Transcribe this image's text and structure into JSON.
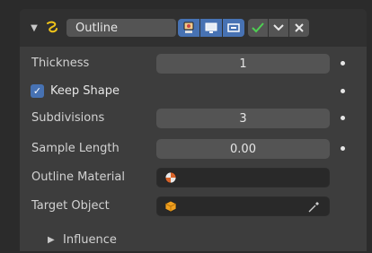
{
  "modifier": {
    "name": "Outline",
    "icon": "grease-pencil-icon",
    "toggle_icons": [
      "render-icon",
      "viewport-icon",
      "editmode-icon"
    ],
    "action_icons": [
      "apply-check-icon",
      "dropdown-chevron-icon",
      "close-icon"
    ]
  },
  "properties": {
    "thickness": {
      "label": "Thickness",
      "value": "1"
    },
    "keep_shape": {
      "label": "Keep Shape",
      "checked": true
    },
    "subdivisions": {
      "label": "Subdivisions",
      "value": "3"
    },
    "sample_length": {
      "label": "Sample Length",
      "value": "0.00"
    },
    "outline_material": {
      "label": "Outline Material",
      "value": ""
    },
    "target_object": {
      "label": "Target Object",
      "value": ""
    }
  },
  "subpanels": {
    "influence": {
      "label": "Influence"
    }
  },
  "colors": {
    "accent": "#4772b3",
    "panel_bg": "#3d3d3d",
    "field_bg": "#545454",
    "check_green": "#4ecf52"
  }
}
